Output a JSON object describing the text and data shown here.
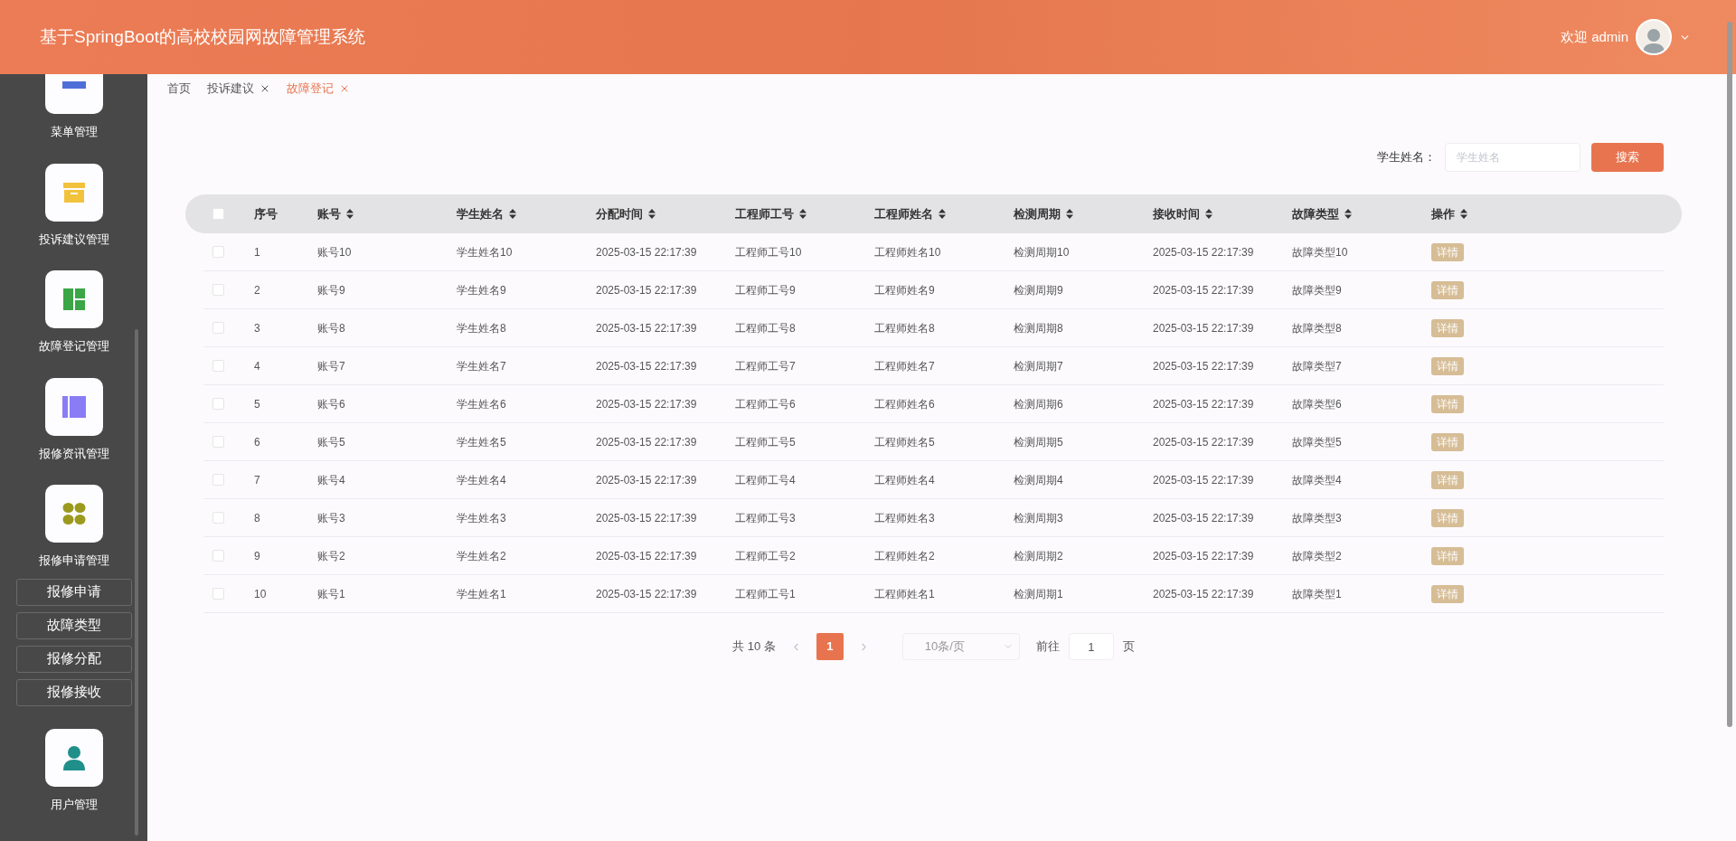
{
  "header": {
    "title": "基于SpringBoot的高校校园网故障管理系统",
    "greeting": "欢迎 admin"
  },
  "sidebar": {
    "items": [
      {
        "label": "菜单管理"
      },
      {
        "label": "投诉建议管理"
      },
      {
        "label": "故障登记管理"
      },
      {
        "label": "报修资讯管理"
      },
      {
        "label": "报修申请管理",
        "children": [
          {
            "label": "报修申请"
          },
          {
            "label": "故障类型"
          },
          {
            "label": "报修分配"
          },
          {
            "label": "报修接收"
          }
        ]
      },
      {
        "label": "用户管理"
      }
    ]
  },
  "tabs": [
    {
      "label": "首页",
      "selected": false,
      "closable": false
    },
    {
      "label": "投诉建议",
      "selected": false,
      "closable": true
    },
    {
      "label": "故障登记",
      "selected": true,
      "closable": true
    }
  ],
  "search": {
    "label": "学生姓名：",
    "placeholder": "学生姓名",
    "button": "搜索"
  },
  "table": {
    "header_checked": false,
    "columns": [
      {
        "label": "序号",
        "sortable": false
      },
      {
        "label": "账号",
        "sortable": true
      },
      {
        "label": "学生姓名",
        "sortable": true
      },
      {
        "label": "分配时间",
        "sortable": true
      },
      {
        "label": "工程师工号",
        "sortable": true
      },
      {
        "label": "工程师姓名",
        "sortable": true
      },
      {
        "label": "检测周期",
        "sortable": true
      },
      {
        "label": "接收时间",
        "sortable": true
      },
      {
        "label": "故障类型",
        "sortable": true
      },
      {
        "label": "操作",
        "sortable": true
      }
    ],
    "rows": [
      {
        "checked": false,
        "cells": [
          "1",
          "账号10",
          "学生姓名10",
          "2025-03-15 22:17:39",
          "工程师工号10",
          "工程师姓名10",
          "检测周期10",
          "2025-03-15 22:17:39",
          "故障类型10"
        ],
        "action": "详情"
      },
      {
        "checked": false,
        "cells": [
          "2",
          "账号9",
          "学生姓名9",
          "2025-03-15 22:17:39",
          "工程师工号9",
          "工程师姓名9",
          "检测周期9",
          "2025-03-15 22:17:39",
          "故障类型9"
        ],
        "action": "详情"
      },
      {
        "checked": false,
        "cells": [
          "3",
          "账号8",
          "学生姓名8",
          "2025-03-15 22:17:39",
          "工程师工号8",
          "工程师姓名8",
          "检测周期8",
          "2025-03-15 22:17:39",
          "故障类型8"
        ],
        "action": "详情"
      },
      {
        "checked": false,
        "cells": [
          "4",
          "账号7",
          "学生姓名7",
          "2025-03-15 22:17:39",
          "工程师工号7",
          "工程师姓名7",
          "检测周期7",
          "2025-03-15 22:17:39",
          "故障类型7"
        ],
        "action": "详情"
      },
      {
        "checked": false,
        "cells": [
          "5",
          "账号6",
          "学生姓名6",
          "2025-03-15 22:17:39",
          "工程师工号6",
          "工程师姓名6",
          "检测周期6",
          "2025-03-15 22:17:39",
          "故障类型6"
        ],
        "action": "详情"
      },
      {
        "checked": false,
        "cells": [
          "6",
          "账号5",
          "学生姓名5",
          "2025-03-15 22:17:39",
          "工程师工号5",
          "工程师姓名5",
          "检测周期5",
          "2025-03-15 22:17:39",
          "故障类型5"
        ],
        "action": "详情"
      },
      {
        "checked": false,
        "cells": [
          "7",
          "账号4",
          "学生姓名4",
          "2025-03-15 22:17:39",
          "工程师工号4",
          "工程师姓名4",
          "检测周期4",
          "2025-03-15 22:17:39",
          "故障类型4"
        ],
        "action": "详情"
      },
      {
        "checked": false,
        "cells": [
          "8",
          "账号3",
          "学生姓名3",
          "2025-03-15 22:17:39",
          "工程师工号3",
          "工程师姓名3",
          "检测周期3",
          "2025-03-15 22:17:39",
          "故障类型3"
        ],
        "action": "详情"
      },
      {
        "checked": false,
        "cells": [
          "9",
          "账号2",
          "学生姓名2",
          "2025-03-15 22:17:39",
          "工程师工号2",
          "工程师姓名2",
          "检测周期2",
          "2025-03-15 22:17:39",
          "故障类型2"
        ],
        "action": "详情"
      },
      {
        "checked": false,
        "cells": [
          "10",
          "账号1",
          "学生姓名1",
          "2025-03-15 22:17:39",
          "工程师工号1",
          "工程师姓名1",
          "检测周期1",
          "2025-03-15 22:17:39",
          "故障类型1"
        ],
        "action": "详情"
      }
    ]
  },
  "pagination": {
    "total": "共 10 条",
    "pages": [
      {
        "label": "1",
        "selected": true
      }
    ],
    "page_size": "10条/页",
    "goto_label": "前往",
    "goto_value": "1",
    "goto_suffix": "页"
  }
}
